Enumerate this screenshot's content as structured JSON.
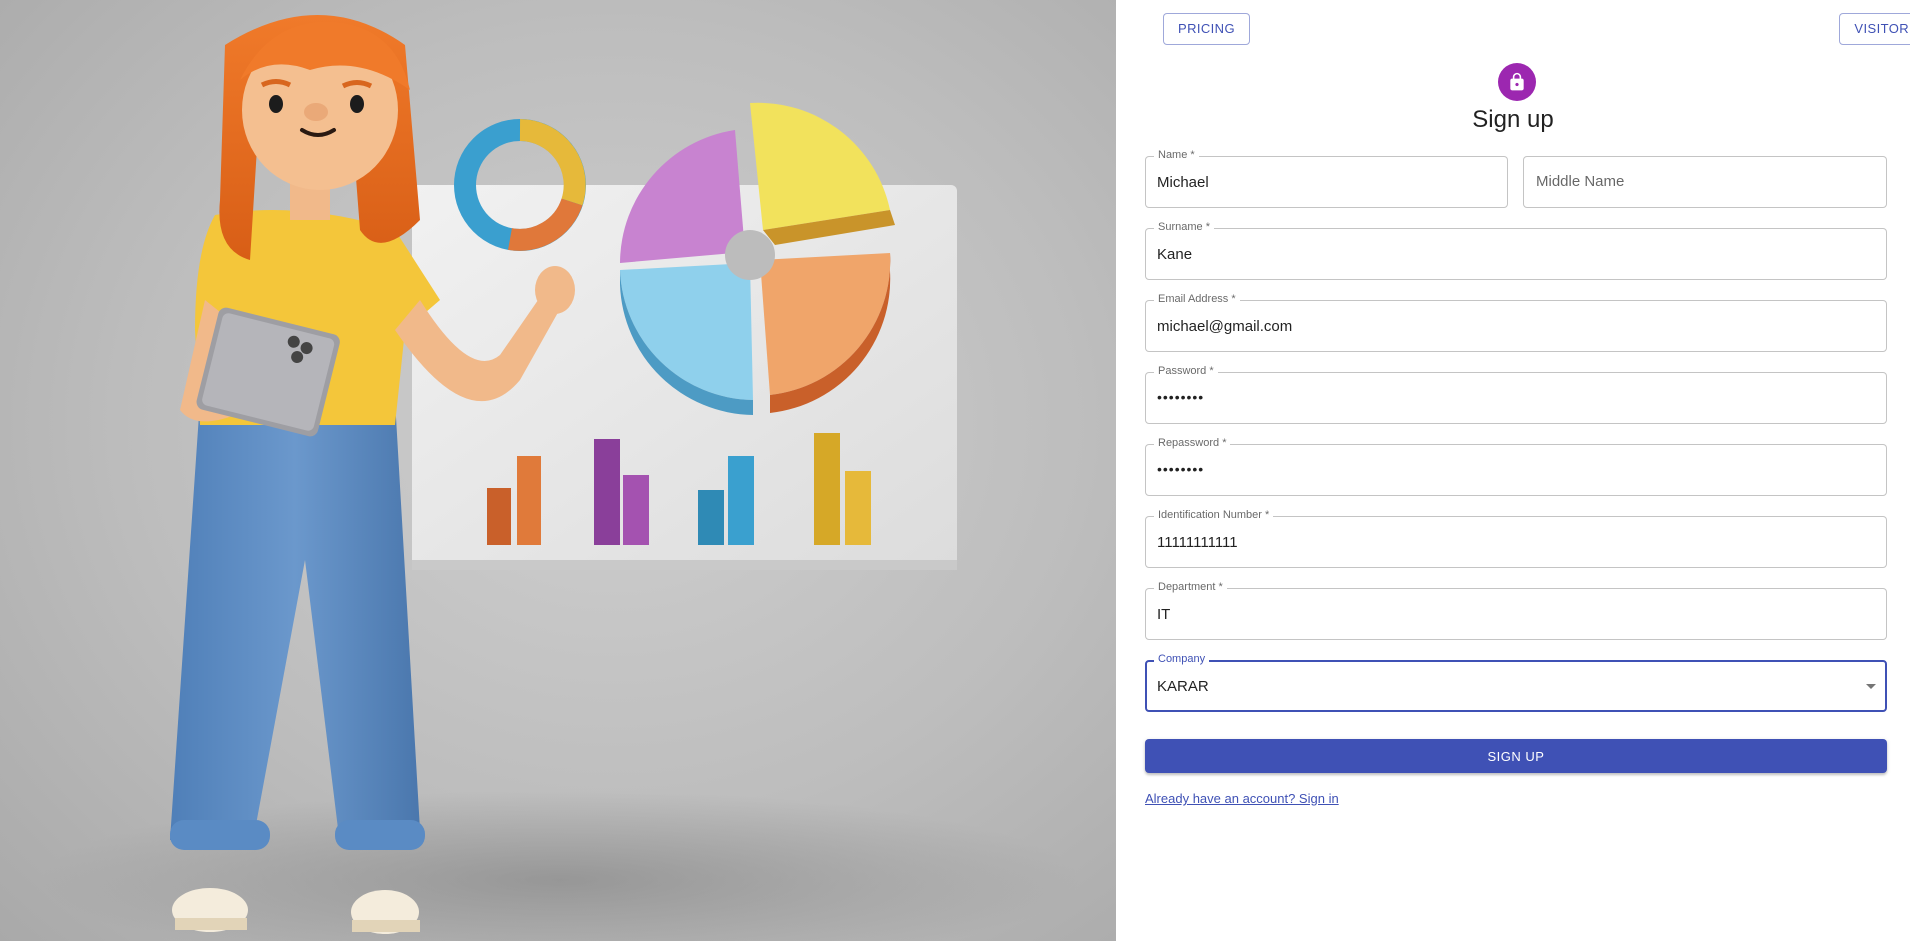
{
  "header": {
    "pricing_label": "PRICING",
    "visitor_label": "VISITOR"
  },
  "form": {
    "title": "Sign up",
    "avatar_icon": "lock-icon",
    "avatar_color": "#9c27b0",
    "fields": {
      "name": {
        "label": "Name *",
        "value": "Michael"
      },
      "middle_name": {
        "placeholder": "Middle Name"
      },
      "surname": {
        "label": "Surname *",
        "value": "Kane"
      },
      "email": {
        "label": "Email Address *",
        "value": "michael@gmail.com"
      },
      "password": {
        "label": "Password *",
        "value": "••••••••"
      },
      "repassword": {
        "label": "Repassword *",
        "value": "••••••••"
      },
      "identification_number": {
        "label": "Identification Number *",
        "value": "11111111111"
      },
      "department": {
        "label": "Department *",
        "value": "IT"
      },
      "company": {
        "label": "Company",
        "value": "KARAR"
      }
    },
    "submit_label": "SIGN UP",
    "signin_link": "Already have an account? Sign in",
    "accent_color": "#3f51b5"
  },
  "illustration": {
    "description_icon": "character-with-charts-illustration"
  }
}
